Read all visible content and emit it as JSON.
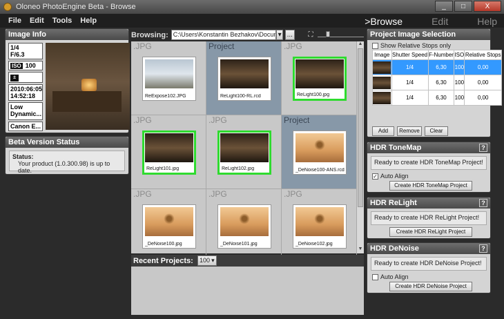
{
  "window": {
    "title": "Oloneo PhotoEngine Beta - Browse",
    "min": "_",
    "max": "□",
    "close": "X"
  },
  "menu": [
    "File",
    "Edit",
    "Tools",
    "Help"
  ],
  "modes": [
    "Browse",
    "Edit",
    "Help"
  ],
  "image_info": {
    "title": "Image Info",
    "shutter": "1/4",
    "fnumber": "F/6.3",
    "iso": "100",
    "date": "2010:06:05",
    "time": "14:52:18",
    "range": "Low Dynamic...",
    "camera": "Canon E..."
  },
  "beta": {
    "title": "Beta Version Status",
    "status_label": "Status:",
    "status_text": "Your product (1.0.300.98) is up to date."
  },
  "browsing": {
    "label": "Browsing:",
    "path": "C:\\Users\\Konstantin Bezhakov\\Documents\\Olo",
    "browse_btn": "..."
  },
  "grid": [
    {
      "type": ".JPG",
      "label": "ReExpose102.JPG",
      "img": "out",
      "project": false,
      "selected": false
    },
    {
      "type": "Project",
      "label": "ReLight100-RL.rcd",
      "img": "dark",
      "project": true,
      "selected": false
    },
    {
      "type": ".JPG",
      "label": "ReLight100.jpg",
      "img": "dark",
      "project": false,
      "selected": true
    },
    {
      "type": ".JPG",
      "label": "ReLight101.jpg",
      "img": "dark",
      "project": false,
      "selected": true
    },
    {
      "type": ".JPG",
      "label": "ReLight102.jpg",
      "img": "dark",
      "project": false,
      "selected": true
    },
    {
      "type": "Project",
      "label": "_DeNoise100-ANS.rcd",
      "img": "flower",
      "project": true,
      "selected": false
    },
    {
      "type": ".JPG",
      "label": "_DeNoise100.jpg",
      "img": "flower",
      "project": false,
      "selected": false
    },
    {
      "type": ".JPG",
      "label": "_DeNoise101.jpg",
      "img": "flower",
      "project": false,
      "selected": false
    },
    {
      "type": ".JPG",
      "label": "_DeNoise102.jpg",
      "img": "flower",
      "project": false,
      "selected": false
    }
  ],
  "recent": {
    "label": "Recent Projects:",
    "count": "100"
  },
  "selection": {
    "title": "Project Image Selection",
    "show_relative": "Show Relative Stops only",
    "headers": [
      "Image",
      "Shutter Speed",
      "F-Number",
      "ISO",
      "Relative Stops"
    ],
    "rows": [
      {
        "shutter": "1/4",
        "fnumber": "6,30",
        "iso": "100",
        "stops": "0,00"
      },
      {
        "shutter": "1/4",
        "fnumber": "6,30",
        "iso": "100",
        "stops": "0,00"
      },
      {
        "shutter": "1/4",
        "fnumber": "6,30",
        "iso": "100",
        "stops": "0,00"
      }
    ],
    "add": "Add",
    "remove": "Remove",
    "clear": "Clear"
  },
  "tonemap": {
    "title": "HDR ToneMap",
    "help": "?",
    "status": "Ready to create HDR ToneMap Project!",
    "auto_align": "Auto Align",
    "button": "Create HDR ToneMap Project"
  },
  "relight": {
    "title": "HDR ReLight",
    "help": "?",
    "status": "Ready to create HDR ReLight Project!",
    "button": "Create HDR ReLight Project"
  },
  "denoise": {
    "title": "HDR DeNoise",
    "help": "?",
    "status": "Ready to create HDR DeNoise Project!",
    "auto_align": "Auto Align",
    "button": "Create HDR DeNoise Project"
  },
  "colors": {
    "selection_green": "#2fdb2f",
    "selected_row": "#3399ff",
    "project_bg": "#8798a8"
  }
}
